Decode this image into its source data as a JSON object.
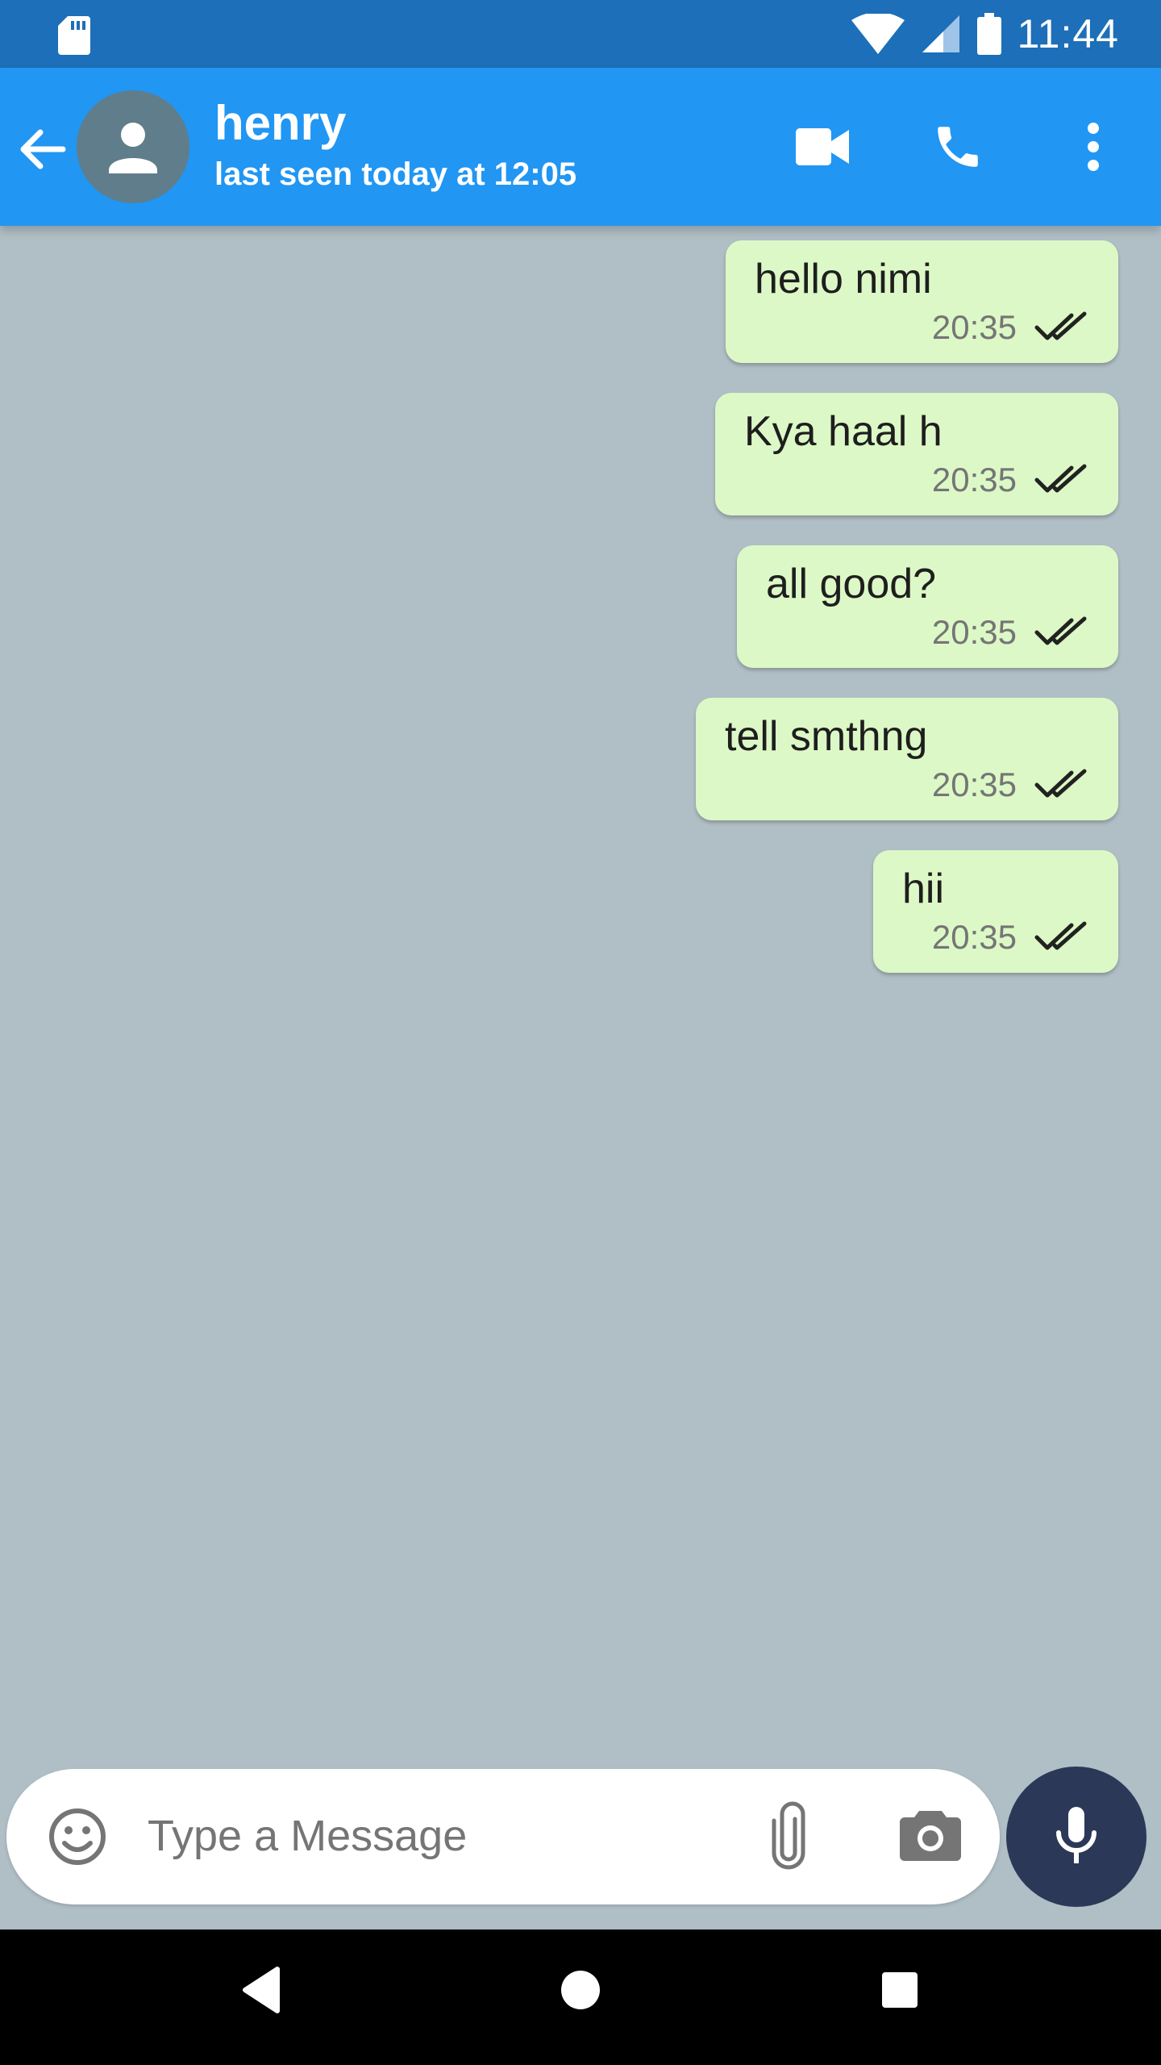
{
  "status_bar": {
    "time": "11:44"
  },
  "header": {
    "name": "henry",
    "status": "last seen today at 12:05"
  },
  "messages": [
    {
      "text": "hello nimi",
      "time": "20:35",
      "read": true
    },
    {
      "text": "Kya haal h",
      "time": "20:35",
      "read": true
    },
    {
      "text": "all good?",
      "time": "20:35",
      "read": true
    },
    {
      "text": "tell smthng",
      "time": "20:35",
      "read": true
    },
    {
      "text": "hii",
      "time": "20:35",
      "read": true
    }
  ],
  "composer": {
    "placeholder": "Type a Message"
  },
  "colors": {
    "app_bar": "#2196f3",
    "status_bar": "#1c6fb8",
    "chat_background": "#b0bec5",
    "outgoing_bubble": "#dcf8c6",
    "mic_button": "#2c3858"
  },
  "icons": [
    "sd-card-icon",
    "wifi-icon",
    "signal-icon",
    "battery-icon",
    "back-arrow-icon",
    "person-icon",
    "video-call-icon",
    "phone-icon",
    "more-vert-icon",
    "double-check-icon",
    "emoji-icon",
    "attach-icon",
    "camera-icon",
    "mic-icon",
    "nav-back-icon",
    "nav-home-icon",
    "nav-recents-icon"
  ]
}
